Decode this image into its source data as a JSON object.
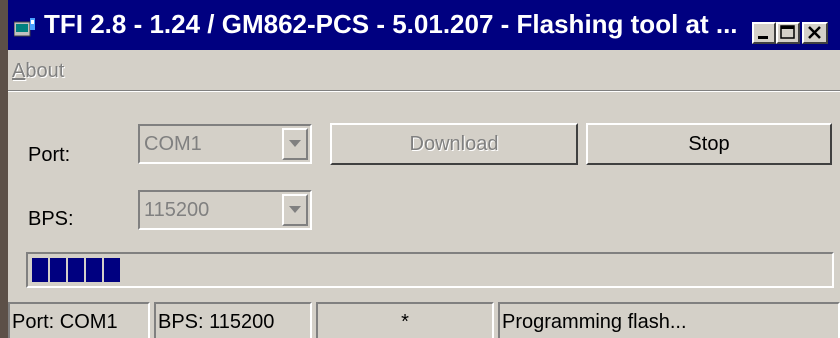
{
  "window": {
    "title": "TFI 2.8 - 1.24 / GM862-PCS - 5.01.207 - Flashing tool at ...",
    "controls": [
      "minimize-icon",
      "maximize-icon",
      "close-icon"
    ]
  },
  "menu": {
    "about_label": "About",
    "about_mnemonic": "A",
    "about_rest": "bout"
  },
  "form": {
    "port_label": "Port:",
    "port_value": "COM1",
    "bps_label": "BPS:",
    "bps_value": "115200",
    "download_label": "Download",
    "stop_label": "Stop"
  },
  "progress": {
    "filled_blocks": 5,
    "fraction": 0.12
  },
  "statusbar": {
    "port": "Port: COM1",
    "bps": "BPS: 115200",
    "indicator": "*",
    "message": "Programming flash..."
  },
  "colors": {
    "titlebar": "#000080",
    "face": "#d4d0c8",
    "progress_fill": "#000080"
  }
}
